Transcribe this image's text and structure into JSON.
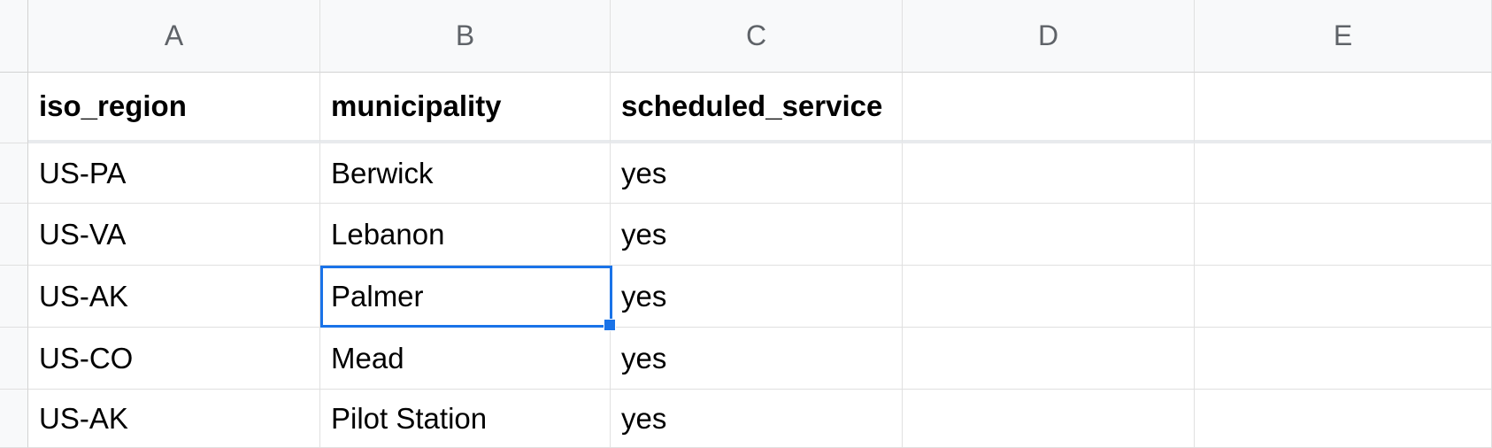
{
  "columns": [
    "A",
    "B",
    "C",
    "D",
    "E"
  ],
  "headers": {
    "A": "iso_region",
    "B": "municipality",
    "C": "scheduled_service",
    "D": "",
    "E": ""
  },
  "rows": [
    {
      "A": "US-PA",
      "B": "Berwick",
      "C": "yes",
      "D": "",
      "E": ""
    },
    {
      "A": "US-VA",
      "B": "Lebanon",
      "C": "yes",
      "D": "",
      "E": ""
    },
    {
      "A": "US-AK",
      "B": "Palmer",
      "C": "yes",
      "D": "",
      "E": ""
    },
    {
      "A": "US-CO",
      "B": "Mead",
      "C": "yes",
      "D": "",
      "E": ""
    },
    {
      "A": "US-AK",
      "B": "Pilot Station",
      "C": "yes",
      "D": "",
      "E": ""
    }
  ],
  "selected_cell": "B4"
}
